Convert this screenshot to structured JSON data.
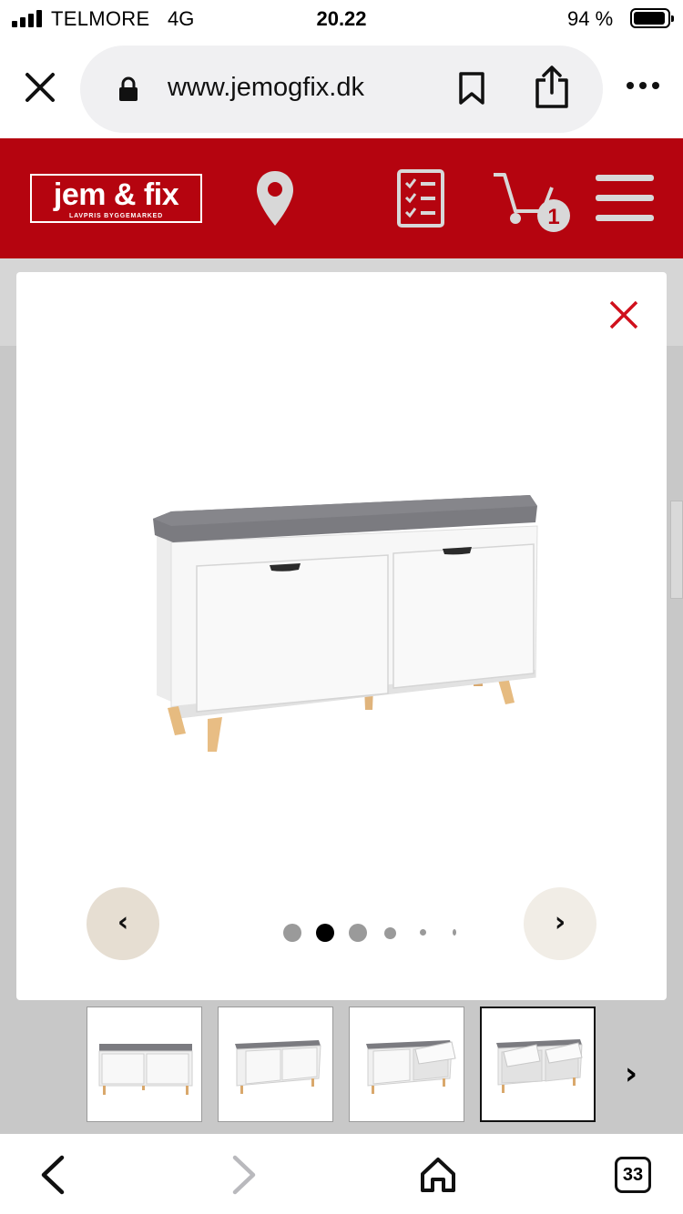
{
  "status_bar": {
    "carrier": "TELMORE",
    "network": "4G",
    "time": "20.22",
    "battery_percent": "94 %",
    "battery_level": 0.94
  },
  "browser": {
    "url": "www.jemogfix.dk",
    "icons": [
      "close-icon",
      "lock-icon",
      "bookmark-icon",
      "share-icon",
      "more-icon"
    ]
  },
  "site_header": {
    "logo_text": "jem & fix",
    "logo_tagline": "LAVPRIS BYGGEMARKED",
    "cart_count": "1",
    "brand_color": "#b5040f",
    "icons": [
      "location-pin-icon",
      "checklist-icon",
      "cart-icon",
      "hamburger-menu-icon"
    ]
  },
  "gallery": {
    "prev_label": "‹",
    "next_label": "›",
    "active_dot_index": 1,
    "dot_count": 6,
    "thumbnails_next_label": "›",
    "active_thumbnail_index": 3,
    "thumbnail_count": 4,
    "close_color": "#d0101c"
  },
  "toolbar": {
    "tab_count": "33",
    "icons": [
      "back-arrow-icon",
      "forward-arrow-icon",
      "home-icon",
      "tabs-icon"
    ]
  }
}
